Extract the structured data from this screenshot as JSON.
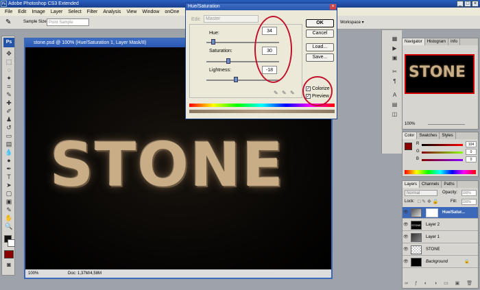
{
  "app_title": "Adobe Photoshop CS3 Extended",
  "app_icon": "Ps",
  "window_controls": [
    "_",
    "□",
    "×"
  ],
  "menu": [
    "File",
    "Edit",
    "Image",
    "Layer",
    "Select",
    "Filter",
    "Analysis",
    "View",
    "Window",
    "onOne",
    "Help"
  ],
  "options": {
    "sample_size_label": "Sample Size:",
    "sample_size_value": "Point Sample",
    "workspace_label": "Workspace ▾"
  },
  "toolbox": {
    "logo": "Ps"
  },
  "document": {
    "title": "stone.psd @ 100% (Hue/Saturation 1, Layer Mask/8)",
    "canvas_text": "STONE",
    "zoom": "100%",
    "doc_info": "Doc: 1,37M/4,58M"
  },
  "dialog": {
    "title": "Hue/Saturation",
    "close": "×",
    "edit_label": "Edit:",
    "edit_value": "Master",
    "hue_label": "Hue:",
    "hue_value": "34",
    "hue_level": 34,
    "sat_label": "Saturation:",
    "sat_value": "30",
    "sat_level": 30,
    "light_label": "Lightness:",
    "light_value": "-18",
    "light_level": -18,
    "ok": "OK",
    "cancel": "Cancel",
    "load": "Load...",
    "save": "Save...",
    "colorize_label": "Colorize",
    "colorize_checked": true,
    "preview_label": "Preview",
    "preview_checked": true,
    "check_mark": "✓"
  },
  "navigator": {
    "tabs": [
      "Navigator",
      "Histogram",
      "Info"
    ],
    "preview_text": "STONE",
    "zoom": "100%"
  },
  "color_panel": {
    "tabs": [
      "Color",
      "Swatches",
      "Styles"
    ],
    "r_label": "R",
    "g_label": "G",
    "b_label": "B",
    "r": "104",
    "g": "0",
    "b": "0",
    "fg_color": "#8b0000"
  },
  "layers_panel": {
    "tabs": [
      "Layers",
      "Channels",
      "Paths"
    ],
    "blend_mode": "Normal",
    "opacity_label": "Opacity:",
    "opacity": "100%",
    "lock_label": "Lock:",
    "fill_label": "Fill:",
    "fill": "100%",
    "layers": [
      {
        "name": "Hue/Satur...",
        "selected": true
      },
      {
        "name": "Layer 2",
        "selected": false
      },
      {
        "name": "Layer 1",
        "selected": false
      },
      {
        "name": "STONE",
        "selected": false
      },
      {
        "name": "Background",
        "selected": false
      }
    ]
  },
  "colors": {
    "accent": "#2a58b0",
    "annotation": "#c0102a"
  }
}
